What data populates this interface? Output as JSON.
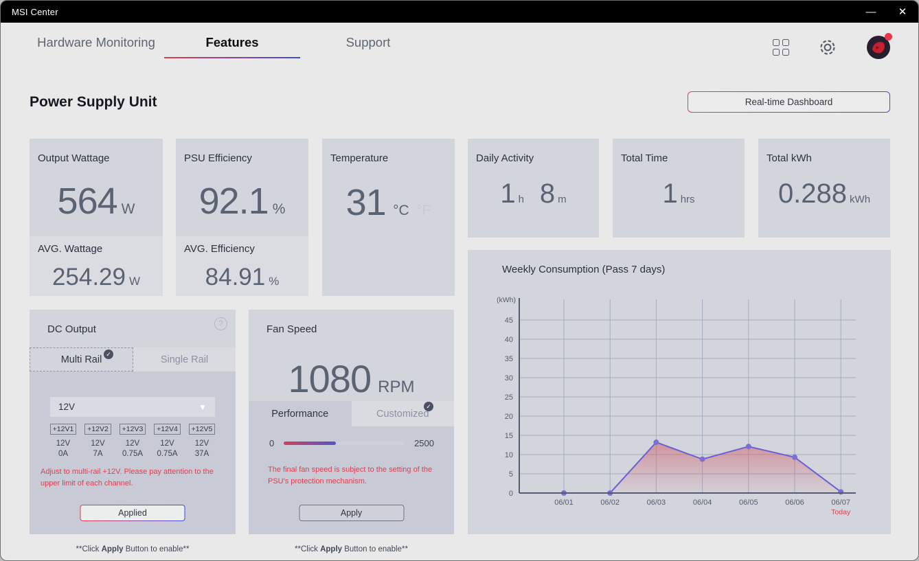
{
  "window": {
    "title": "MSI Center"
  },
  "titlebar_icons": {
    "minimize": "—",
    "close": "✕"
  },
  "nav": {
    "tabs": [
      {
        "label": "Hardware Monitoring",
        "active": false
      },
      {
        "label": "Features",
        "active": true
      },
      {
        "label": "Support",
        "active": false
      }
    ]
  },
  "header": {
    "title": "Power Supply Unit",
    "dashboard_button": "Real-time Dashboard"
  },
  "stats": {
    "output_wattage": {
      "label": "Output Wattage",
      "value": "564",
      "unit": "W",
      "avg_label": "AVG. Wattage",
      "avg_value": "254.29",
      "avg_unit": "W"
    },
    "psu_efficiency": {
      "label": "PSU Efficiency",
      "value": "92.1",
      "unit": "%",
      "avg_label": "AVG. Efficiency",
      "avg_value": "84.91",
      "avg_unit": "%"
    },
    "temperature": {
      "label": "Temperature",
      "value": "31",
      "unit_c": "°C",
      "unit_f": "°F"
    },
    "daily_activity": {
      "label": "Daily Activity",
      "hours": "1",
      "hours_unit": "h",
      "minutes": "8",
      "minutes_unit": "m"
    },
    "total_time": {
      "label": "Total Time",
      "value": "1",
      "unit": "hrs"
    },
    "total_kwh": {
      "label": "Total kWh",
      "value": "0.288",
      "unit": "kWh"
    }
  },
  "dc_output": {
    "title": "DC Output",
    "help_icon": "?",
    "tabs": [
      {
        "label": "Multi Rail",
        "selected": true,
        "checked": true
      },
      {
        "label": "Single Rail",
        "selected": false,
        "checked": false
      }
    ],
    "dropdown_value": "12V",
    "rails": [
      {
        "button": "+12V1",
        "voltage": "12V",
        "current": "0A"
      },
      {
        "button": "+12V2",
        "voltage": "12V",
        "current": "7A"
      },
      {
        "button": "+12V3",
        "voltage": "12V",
        "current": "0.75A"
      },
      {
        "button": "+12V4",
        "voltage": "12V",
        "current": "0.75A"
      },
      {
        "button": "+12V5",
        "voltage": "12V",
        "current": "37A"
      }
    ],
    "warning": "Adjust to multi-rail +12V. Please pay attention to the upper limit of each channel.",
    "apply_button": "Applied",
    "footnote": {
      "prefix": "**Click ",
      "bold": "Apply",
      "suffix": " Button to enable**"
    }
  },
  "fan_speed": {
    "title": "Fan Speed",
    "value": "1080",
    "unit": "RPM",
    "tabs": [
      {
        "label": "Performance",
        "selected": true,
        "checked": false
      },
      {
        "label": "Customized",
        "selected": false,
        "checked": true
      }
    ],
    "slider": {
      "min": "0",
      "max": "2500",
      "value": 1080,
      "max_num": 2500
    },
    "warning": "The final fan speed is subject to the setting of the PSU's protection mechanism.",
    "apply_button": "Apply",
    "footnote": {
      "prefix": "**Click ",
      "bold": "Apply",
      "suffix": " Button to enable**"
    }
  },
  "chart_data": {
    "type": "area",
    "title": "Weekly Consumption (Pass 7 days)",
    "unit_label": "(kWh)",
    "categories": [
      "06/01",
      "06/02",
      "06/03",
      "06/04",
      "06/05",
      "06/06",
      "06/07"
    ],
    "values": [
      0,
      0,
      13.2,
      8.8,
      12.1,
      9.3,
      0.3
    ],
    "yticks": [
      0,
      5,
      10,
      15,
      20,
      25,
      30,
      35,
      40,
      45
    ],
    "ylim": [
      0,
      50
    ],
    "xlabel": "",
    "ylabel": "(kWh)",
    "grid": true,
    "legend": false,
    "today_label": "Today"
  },
  "icons": {
    "check": "✓",
    "dropdown_arrow": "▼"
  },
  "colors": {
    "accent_red": "#e23c4e",
    "accent_blue": "#3d4ed8",
    "warning_red": "#e23c4e",
    "line_purple": "#6c5fd3",
    "area_fill": "#ce5c68",
    "card_bg": "#d3d5dc",
    "inner_bg": "#c8cbd5",
    "value_text": "#5a6372"
  }
}
